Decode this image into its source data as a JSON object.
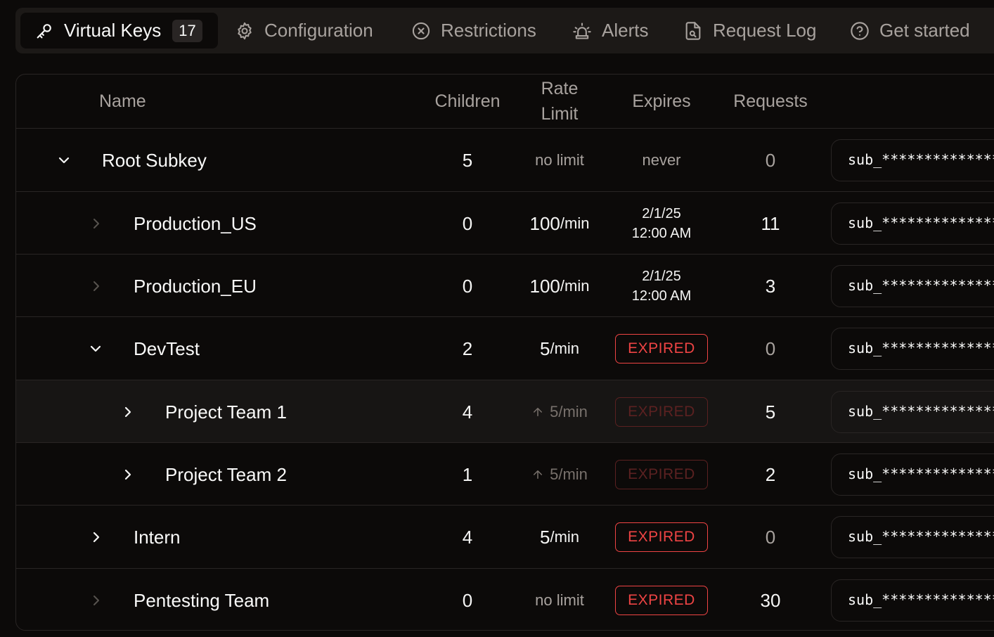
{
  "tabs": [
    {
      "label": "Virtual Keys",
      "icon": "key-icon",
      "badge": "17",
      "active": true
    },
    {
      "label": "Configuration",
      "icon": "gear-icon"
    },
    {
      "label": "Restrictions",
      "icon": "circle-x-icon"
    },
    {
      "label": "Alerts",
      "icon": "siren-icon"
    },
    {
      "label": "Request Log",
      "icon": "file-search-icon"
    },
    {
      "label": "Get started",
      "icon": "help-circle-icon"
    }
  ],
  "table": {
    "headers": {
      "name": "Name",
      "children": "Children",
      "rate_limit_line1": "Rate",
      "rate_limit_line2": "Limit",
      "expires": "Expires",
      "requests": "Requests"
    },
    "rows": [
      {
        "name": "Root Subkey",
        "children": "5",
        "rate": "no limit",
        "expires": "never",
        "requests": "0",
        "key": "sub_***************"
      },
      {
        "name": "Production_US",
        "children": "0",
        "rate_value": "100",
        "rate_unit": "/min",
        "expires_date": "2/1/25",
        "expires_time": "12:00 AM",
        "requests": "11",
        "key": "sub_***************"
      },
      {
        "name": "Production_EU",
        "children": "0",
        "rate_value": "100",
        "rate_unit": "/min",
        "expires_date": "2/1/25",
        "expires_time": "12:00 AM",
        "requests": "3",
        "key": "sub_***************"
      },
      {
        "name": "DevTest",
        "children": "2",
        "rate_value": "5",
        "rate_unit": "/min",
        "expires_badge": "EXPIRED",
        "requests": "0",
        "key": "sub_***************"
      },
      {
        "name": "Project Team 1",
        "children": "4",
        "rate": "5/min",
        "expires_badge": "EXPIRED",
        "requests": "5",
        "key": "sub_***************"
      },
      {
        "name": "Project Team 2",
        "children": "1",
        "rate": "5/min",
        "expires_badge": "EXPIRED",
        "requests": "2",
        "key": "sub_***************"
      },
      {
        "name": "Intern",
        "children": "4",
        "rate_value": "5",
        "rate_unit": "/min",
        "expires_badge": "EXPIRED",
        "requests": "0",
        "key": "sub_***************"
      },
      {
        "name": "Pentesting Team",
        "children": "0",
        "rate": "no limit",
        "expires_badge": "EXPIRED",
        "requests": "30",
        "key": "sub_***************"
      }
    ]
  },
  "colors": {
    "background": "#0c0a09",
    "tabbar": "#1c1917",
    "expired": "#ef4444",
    "expired_inherited": "#5b2121",
    "muted_text": "#a8a29e"
  }
}
